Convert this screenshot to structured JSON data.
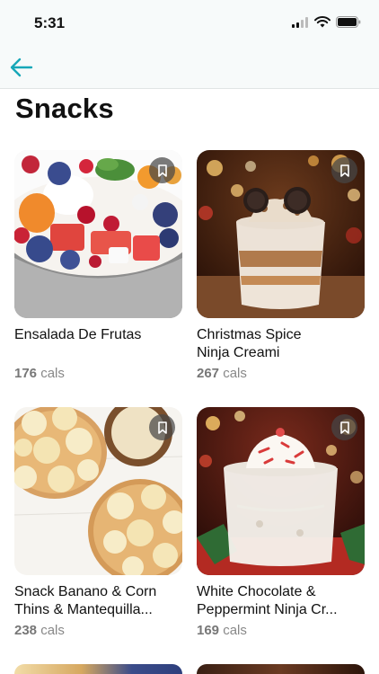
{
  "status_bar": {
    "time": "5:31"
  },
  "nav": {
    "back_icon": "arrow-left-icon",
    "accent": "#17a7b8"
  },
  "page": {
    "title": "Snacks"
  },
  "recipes": [
    {
      "name": "Ensalada De Frutas",
      "cals_value": "176",
      "cals_unit": "cals",
      "icon": "bookmark-icon"
    },
    {
      "name": "Christmas Spice\nNinja Creami",
      "cals_value": "267",
      "cals_unit": "cals",
      "icon": "bookmark-icon"
    },
    {
      "name": "Snack Banano & Corn\nThins & Mantequilla...",
      "cals_value": "238",
      "cals_unit": "cals",
      "icon": "bookmark-icon"
    },
    {
      "name": "White Chocolate &\nPeppermint Ninja Cr...",
      "cals_value": "169",
      "cals_unit": "cals",
      "icon": "bookmark-icon"
    }
  ]
}
